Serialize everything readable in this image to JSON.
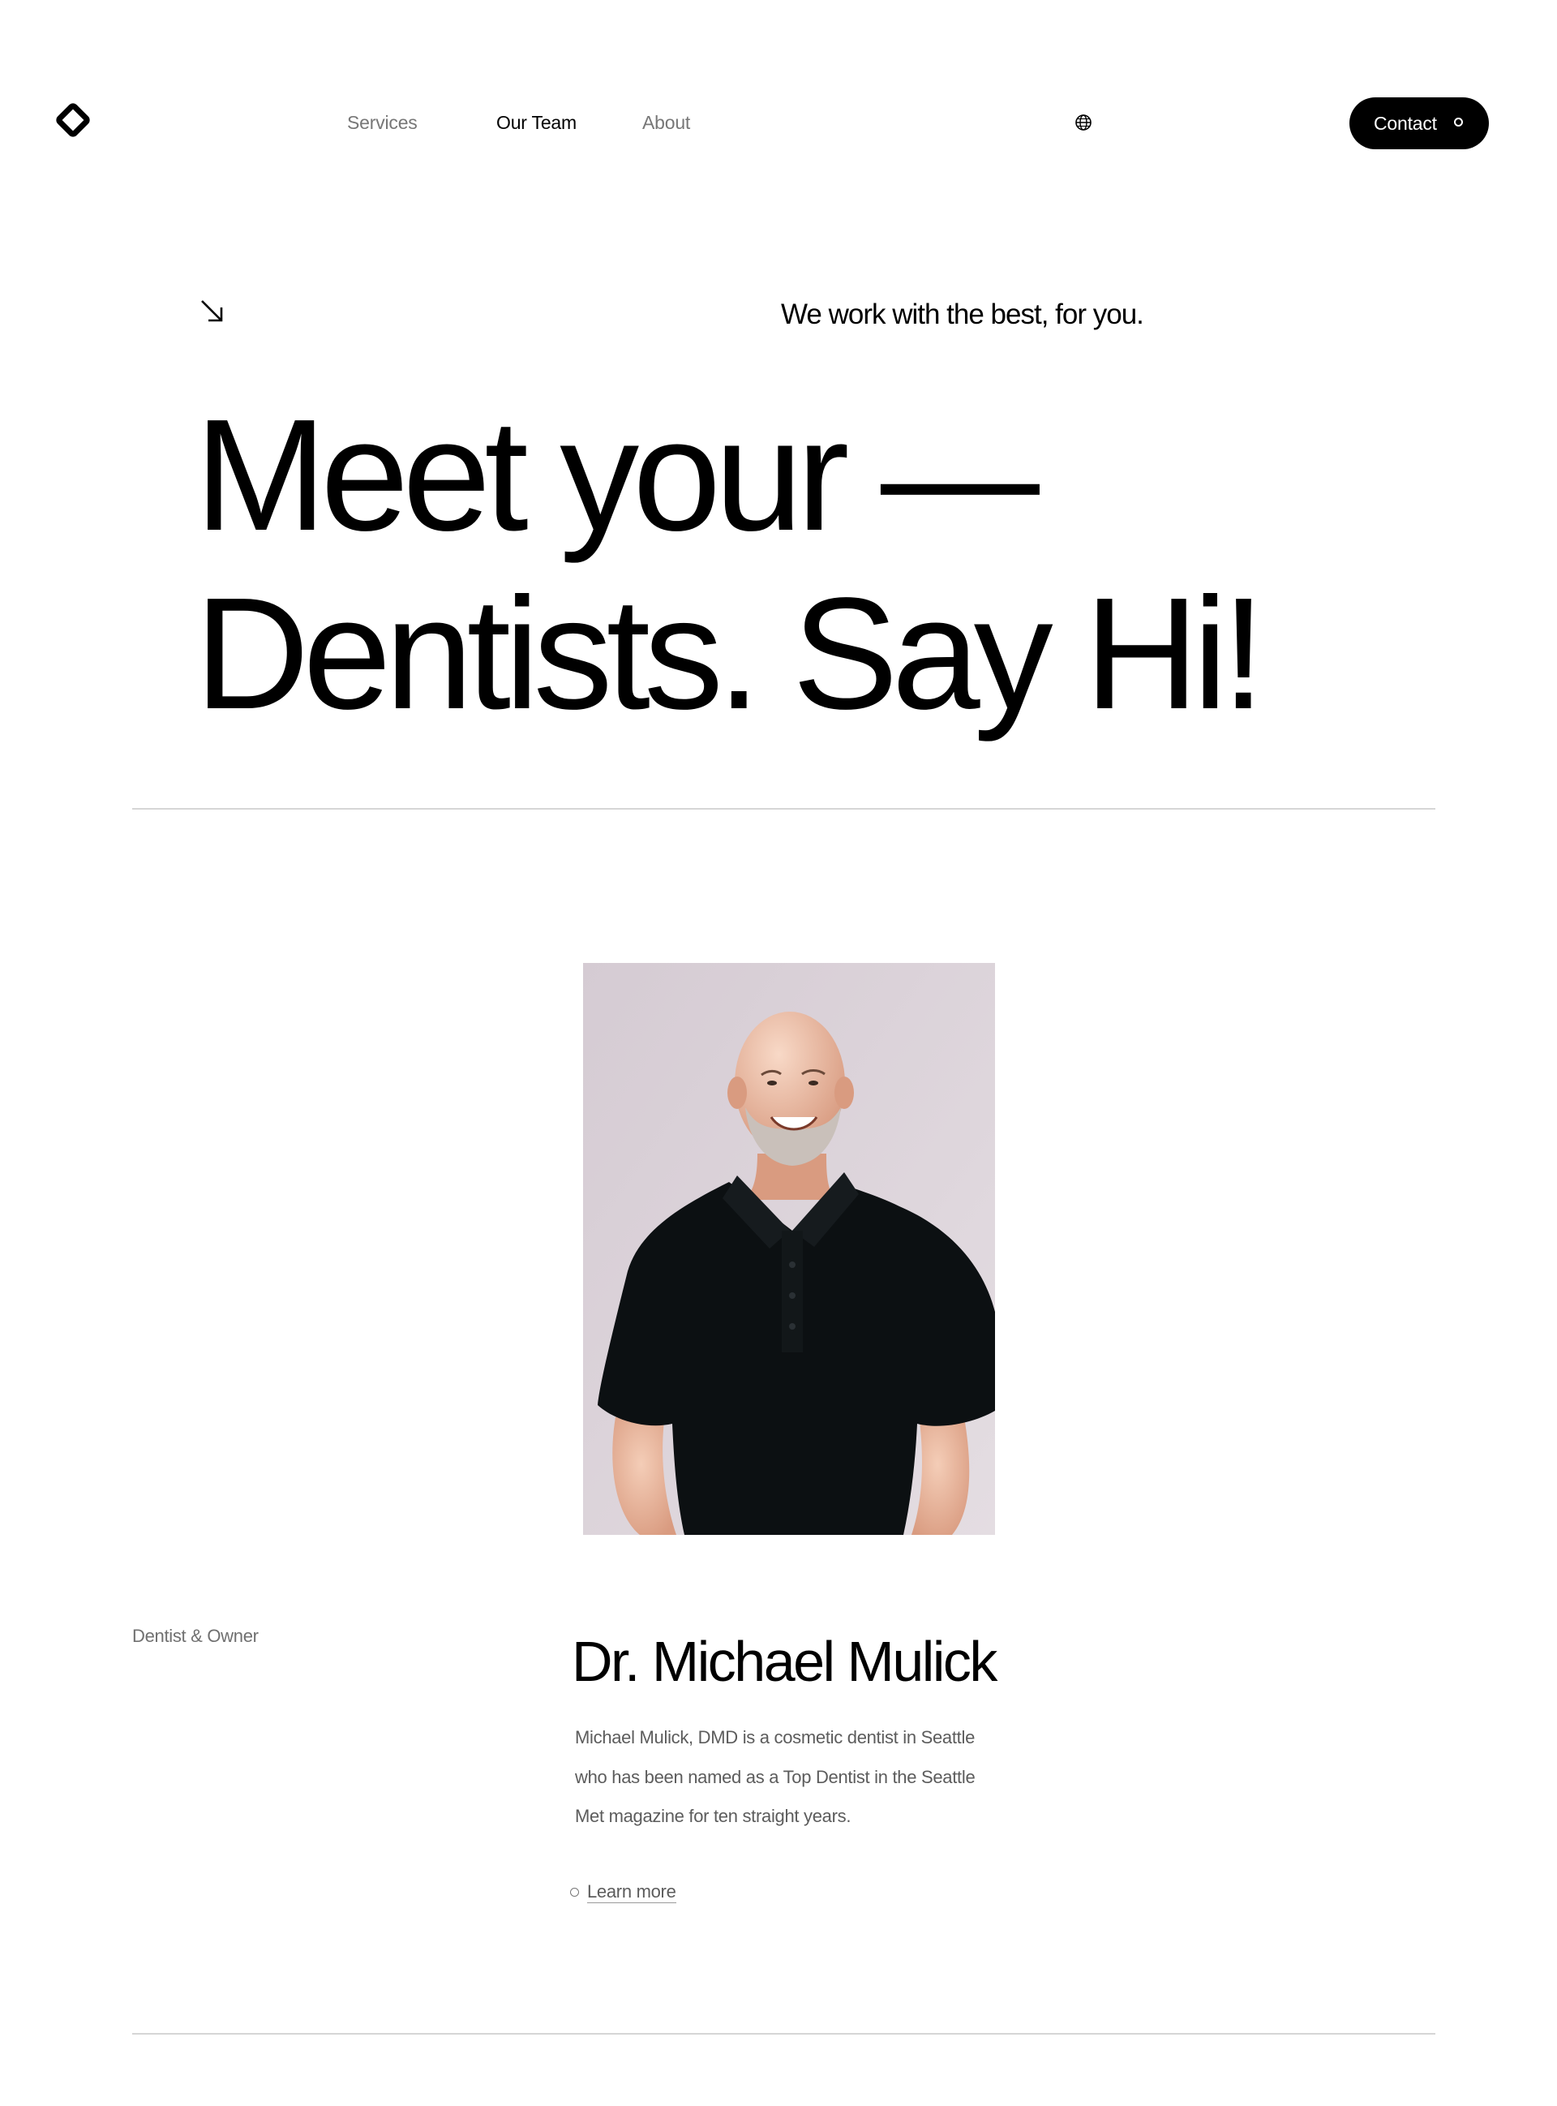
{
  "header": {
    "nav": {
      "services": "Services",
      "our_team": "Our Team",
      "about": "About"
    },
    "contact_label": "Contact"
  },
  "hero": {
    "tagline": "We work with the best, for you.",
    "headline_line1": "Meet your —",
    "headline_line2": "Dentists. Say Hi!"
  },
  "member": {
    "role": "Dentist & Owner",
    "name": "Dr. Michael Mulick",
    "bio_lines": [
      "Michael Mulick, DMD is a cosmetic dentist in Seattle",
      "who has been named as a Top Dentist in the Seattle",
      "Met magazine for ten straight years."
    ],
    "learn_more": "Learn more"
  },
  "colors": {
    "accent": "#000000",
    "muted_text": "#777777",
    "divider": "#d6d6d6",
    "photo_background": "#d8cfd6"
  }
}
